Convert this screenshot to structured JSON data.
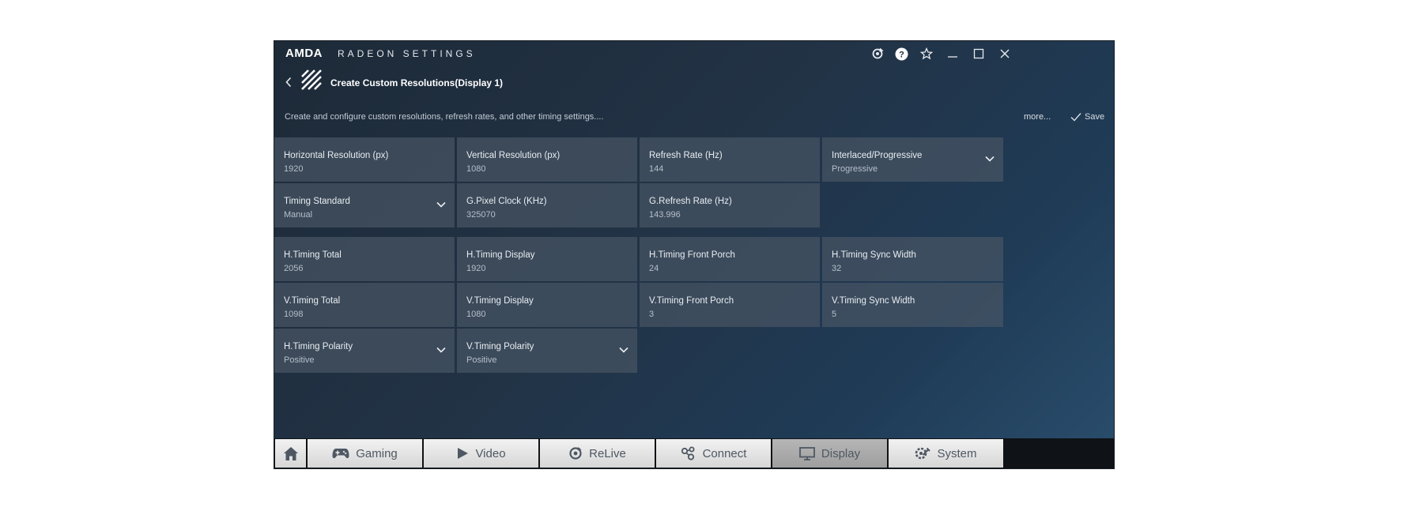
{
  "window": {
    "brand": "AMDA",
    "product": "RADEON SETTINGS",
    "controls": [
      "refresh-icon",
      "help-icon",
      "star-icon",
      "minimize-icon",
      "maximize-icon",
      "close-icon"
    ]
  },
  "header": {
    "page_title": "Create Custom Resolutions(Display 1)",
    "description": "Create and configure custom resolutions, refresh rates, and other timing settings....",
    "more_label": "more...",
    "save_label": "Save"
  },
  "rows": [
    [
      {
        "label": "Horizontal Resolution (px)",
        "value": "1920",
        "dropdown": false
      },
      {
        "label": "Vertical Resolution (px)",
        "value": "1080",
        "dropdown": false
      },
      {
        "label": "Refresh Rate (Hz)",
        "value": "144",
        "dropdown": false
      },
      {
        "label": "Interlaced/Progressive",
        "value": "Progressive",
        "dropdown": true
      }
    ],
    [
      {
        "label": "Timing Standard",
        "value": "Manual",
        "dropdown": true
      },
      {
        "label": "G.Pixel Clock (KHz)",
        "value": "325070",
        "dropdown": false
      },
      {
        "label": "G.Refresh Rate (Hz)",
        "value": "143.996",
        "dropdown": false
      }
    ],
    [
      {
        "label": "H.Timing Total",
        "value": "2056",
        "dropdown": false
      },
      {
        "label": "H.Timing Display",
        "value": "1920",
        "dropdown": false
      },
      {
        "label": "H.Timing Front Porch",
        "value": "24",
        "dropdown": false
      },
      {
        "label": "H.Timing Sync Width",
        "value": "32",
        "dropdown": false
      }
    ],
    [
      {
        "label": "V.Timing Total",
        "value": "1098",
        "dropdown": false
      },
      {
        "label": "V.Timing Display",
        "value": "1080",
        "dropdown": false
      },
      {
        "label": "V.Timing Front Porch",
        "value": "3",
        "dropdown": false
      },
      {
        "label": "V.Timing Sync Width",
        "value": "5",
        "dropdown": false
      }
    ],
    [
      {
        "label": "H.Timing Polarity",
        "value": "Positive",
        "dropdown": true
      },
      {
        "label": "V.Timing Polarity",
        "value": "Positive",
        "dropdown": true
      }
    ]
  ],
  "tabs": [
    {
      "icon": "home-icon",
      "label": ""
    },
    {
      "icon": "gamepad-icon",
      "label": "Gaming"
    },
    {
      "icon": "play-icon",
      "label": "Video"
    },
    {
      "icon": "relive-icon",
      "label": "ReLive"
    },
    {
      "icon": "connect-icon",
      "label": "Connect"
    },
    {
      "icon": "display-icon",
      "label": "Display",
      "selected": true
    },
    {
      "icon": "system-icon",
      "label": "System"
    }
  ],
  "colors": {
    "tile_bg": "#465464",
    "tab_bg_light": "#e6e6e6",
    "tab_bg_selected": "#a9a9a9"
  }
}
